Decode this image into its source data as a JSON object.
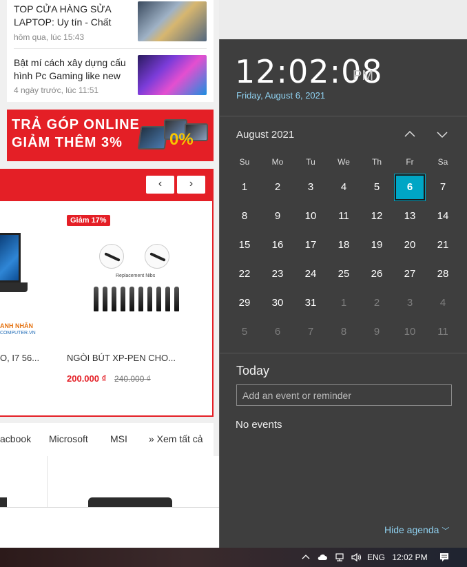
{
  "web": {
    "news": [
      {
        "title": "TOP CỬA HÀNG SỬA LAPTOP: Uy tín - Chất",
        "time": "hôm qua, lúc 15:43"
      },
      {
        "title": "Bật mí cách xây dựng cấu hình Pc Gaming like new",
        "time": "4 ngày trước, lúc 11:51"
      }
    ],
    "banner": {
      "line1": "TRẢ GÓP ONLINE",
      "line2": "GIẢM THÊM 3%",
      "badge": "0%"
    },
    "carousel": {
      "prev": "‹",
      "next": "›"
    },
    "products": [
      {
        "name": "O, I7 56...",
        "brand": "ANH NHÂN",
        "brand_sub": "COMPUTER.VN"
      },
      {
        "badge": "Giảm 17%",
        "image_caption": "Replacement Nibs",
        "name": "NGÒI BÚT XP-PEN CHO...",
        "price": "200.000 ₫",
        "old_price": "240.000 ₫"
      }
    ],
    "brand_tabs": [
      "acbook",
      "Microsoft",
      "MSI",
      "» Xem tất cả"
    ]
  },
  "flyout": {
    "time": "12:02:08",
    "ampm": "PM",
    "date": "Friday, August 6, 2021",
    "month_label": "August 2021",
    "weekdays": [
      "Su",
      "Mo",
      "Tu",
      "We",
      "Th",
      "Fr",
      "Sa"
    ],
    "weeks": [
      [
        "1",
        "2",
        "3",
        "4",
        "5",
        "6",
        "7"
      ],
      [
        "8",
        "9",
        "10",
        "11",
        "12",
        "13",
        "14"
      ],
      [
        "15",
        "16",
        "17",
        "18",
        "19",
        "20",
        "21"
      ],
      [
        "22",
        "23",
        "24",
        "25",
        "26",
        "27",
        "28"
      ],
      [
        "29",
        "30",
        "31",
        "1",
        "2",
        "3",
        "4"
      ],
      [
        "5",
        "6",
        "7",
        "8",
        "9",
        "10",
        "11"
      ]
    ],
    "today": "6",
    "agenda": {
      "title": "Today",
      "placeholder": "Add an event or reminder",
      "no_events": "No events",
      "hide_label": "Hide agenda"
    }
  },
  "taskbar": {
    "language": "ENG",
    "time": "12:02 PM"
  },
  "colors": {
    "accent_today": "#00a6c5",
    "flyout_bg": "#3e3e3e",
    "date_link": "#8fd1f0",
    "brand_red": "#e41f26"
  }
}
